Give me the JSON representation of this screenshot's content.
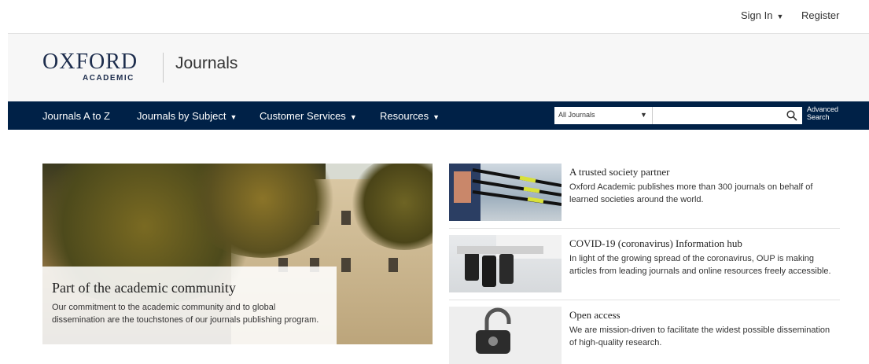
{
  "header": {
    "sign_in": "Sign In",
    "register": "Register",
    "logo_main": "OXFORD",
    "logo_sub": "ACADEMIC",
    "section_title": "Journals"
  },
  "nav": {
    "items": [
      {
        "label": "Journals A to Z",
        "has_menu": false
      },
      {
        "label": "Journals by Subject",
        "has_menu": true
      },
      {
        "label": "Customer Services",
        "has_menu": true
      },
      {
        "label": "Resources",
        "has_menu": true
      }
    ],
    "search_scope": "All Journals",
    "search_placeholder": "",
    "advanced_search": [
      "Advanced",
      "Search"
    ]
  },
  "hero": {
    "title": "Part of the academic community",
    "text": "Our commitment to the academic community and to global dissemination are the touchstones of our journals publishing program."
  },
  "features": [
    {
      "title": "A trusted society partner",
      "text": "Oxford Academic publishes more than 300 journals on behalf of learned societies around the world.",
      "image": "rowing-image"
    },
    {
      "title": "COVID-19 (coronavirus) Information hub",
      "text": "In light of the growing spread of the coronavirus, OUP is making articles from leading journals and online resources freely accessible.",
      "image": "microscope-image"
    },
    {
      "title": "Open access",
      "text": "We are mission-driven to facilitate the widest possible dissemination of high-quality research.",
      "image": "padlock-image"
    }
  ],
  "colors": {
    "nav_bg": "#002147",
    "brand_bg": "#f7f7f7",
    "logo": "#1d2d4d"
  }
}
